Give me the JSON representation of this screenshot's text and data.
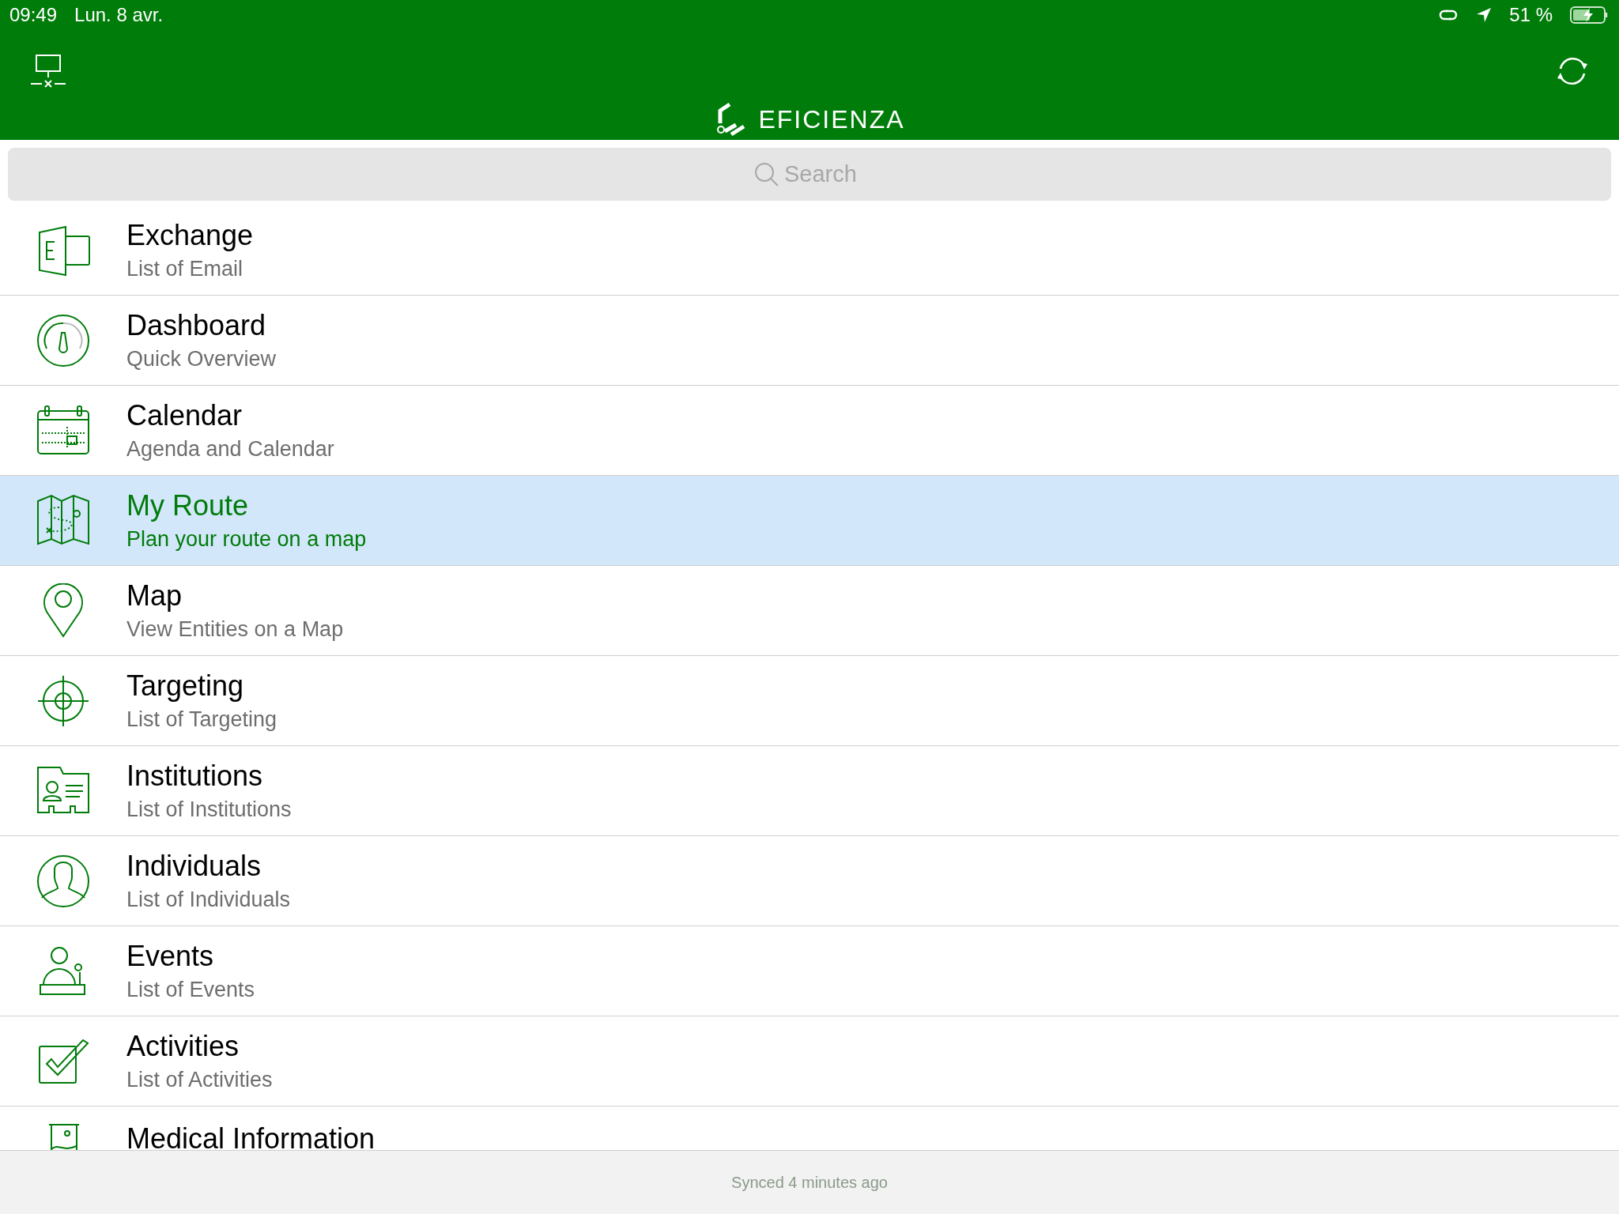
{
  "status_bar": {
    "time": "09:49",
    "date": "Lun. 8 avr.",
    "battery": "51 %"
  },
  "header": {
    "brand": "EFICIENZA"
  },
  "search": {
    "placeholder": "Search"
  },
  "menu": [
    {
      "kind": "exchange",
      "title": "Exchange",
      "subtitle": "List of Email",
      "selected": false
    },
    {
      "kind": "dashboard",
      "title": "Dashboard",
      "subtitle": "Quick Overview",
      "selected": false
    },
    {
      "kind": "calendar",
      "title": "Calendar",
      "subtitle": "Agenda and Calendar",
      "selected": false
    },
    {
      "kind": "route",
      "title": "My Route",
      "subtitle": "Plan your route on a map",
      "selected": true
    },
    {
      "kind": "map",
      "title": "Map",
      "subtitle": "View Entities on a Map",
      "selected": false
    },
    {
      "kind": "target",
      "title": "Targeting",
      "subtitle": "List of Targeting",
      "selected": false
    },
    {
      "kind": "institution",
      "title": "Institutions",
      "subtitle": "List of Institutions",
      "selected": false
    },
    {
      "kind": "individual",
      "title": "Individuals",
      "subtitle": "List of Individuals",
      "selected": false
    },
    {
      "kind": "event",
      "title": "Events",
      "subtitle": "List of Events",
      "selected": false
    },
    {
      "kind": "activity",
      "title": "Activities",
      "subtitle": "List of Activities",
      "selected": false
    },
    {
      "kind": "medical",
      "title": "Medical Information",
      "selected": false
    }
  ],
  "footer": {
    "sync": "Synced 4 minutes ago"
  }
}
